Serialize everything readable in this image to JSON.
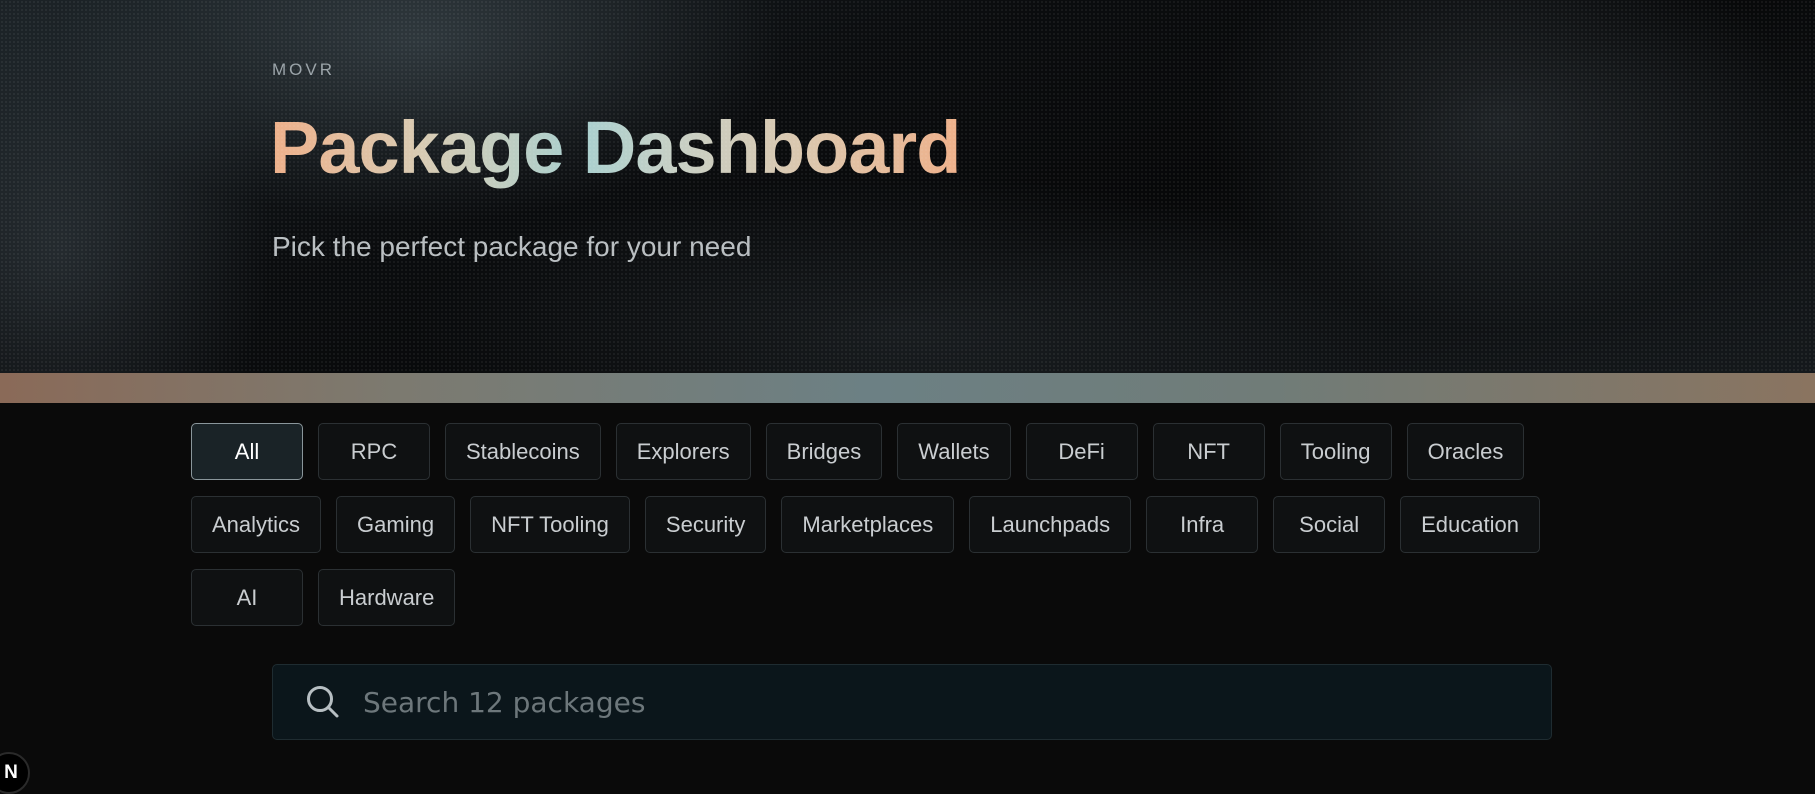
{
  "header": {
    "eyebrow": "MOVR",
    "title": "Package Dashboard",
    "subtitle": "Pick the perfect package for your need"
  },
  "filters": {
    "active": "All",
    "items": [
      {
        "label": "All"
      },
      {
        "label": "RPC"
      },
      {
        "label": "Stablecoins"
      },
      {
        "label": "Explorers"
      },
      {
        "label": "Bridges"
      },
      {
        "label": "Wallets"
      },
      {
        "label": "DeFi"
      },
      {
        "label": "NFT"
      },
      {
        "label": "Tooling"
      },
      {
        "label": "Oracles"
      },
      {
        "label": "Analytics"
      },
      {
        "label": "Gaming"
      },
      {
        "label": "NFT Tooling"
      },
      {
        "label": "Security"
      },
      {
        "label": "Marketplaces"
      },
      {
        "label": "Launchpads"
      },
      {
        "label": "Infra"
      },
      {
        "label": "Social"
      },
      {
        "label": "Education"
      },
      {
        "label": "AI"
      },
      {
        "label": "Hardware"
      }
    ]
  },
  "search": {
    "placeholder": "Search 12 packages",
    "value": "",
    "icon": "search-icon"
  },
  "corner_badge": {
    "label": "N"
  },
  "colors": {
    "background": "#0a0a0a",
    "chip_active_bg": "#1a2327",
    "search_bg": "#0b161b",
    "title_gradient_start": "#eeb08a",
    "title_gradient_mid": "#a9d0cf"
  }
}
